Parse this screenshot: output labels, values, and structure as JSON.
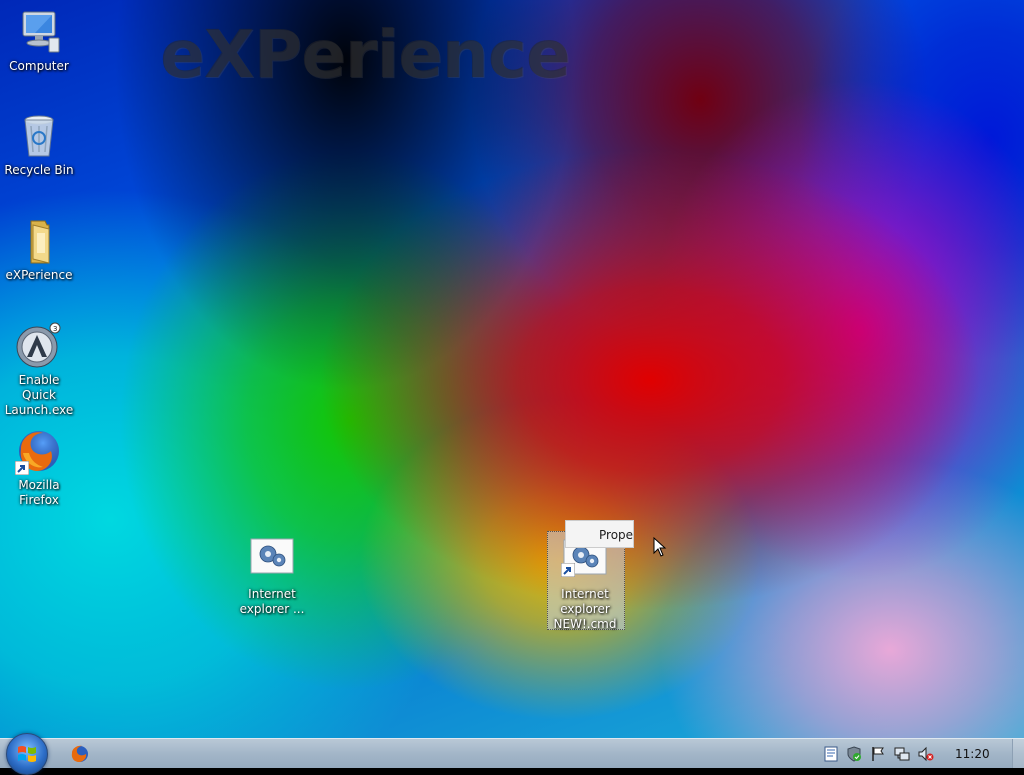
{
  "wallpaper": {
    "text": "eXPerience"
  },
  "desktop_icons": [
    {
      "label": "Computer",
      "icon": "computer-icon"
    },
    {
      "label": "Recycle Bin",
      "icon": "recycle-bin-icon"
    },
    {
      "label": "eXPerience",
      "icon": "folder-icon"
    },
    {
      "label": "Enable Quick Launch.exe",
      "icon": "aimp-icon"
    },
    {
      "label": "Mozilla Firefox",
      "icon": "firefox-icon",
      "shortcut": true
    },
    {
      "label": "Internet explorer ...",
      "icon": "gear-script-icon"
    },
    {
      "label": "Internet explorer NEW!.cmd",
      "icon": "gear-script-icon",
      "shortcut": true,
      "selected": true
    }
  ],
  "drag_tooltip": {
    "text": "Proper"
  },
  "taskbar": {
    "start_icon": "windows-logo-icon",
    "pinned": [
      {
        "name": "Mozilla Firefox",
        "icon": "firefox-icon"
      }
    ],
    "tray_icons": [
      "notes-icon",
      "security-shield-icon",
      "action-center-flag-icon",
      "network-icon",
      "volume-muted-icon"
    ],
    "clock": "11:20"
  },
  "colors": {
    "taskbar": "#a3b6c8",
    "label_text": "#ffffff"
  }
}
